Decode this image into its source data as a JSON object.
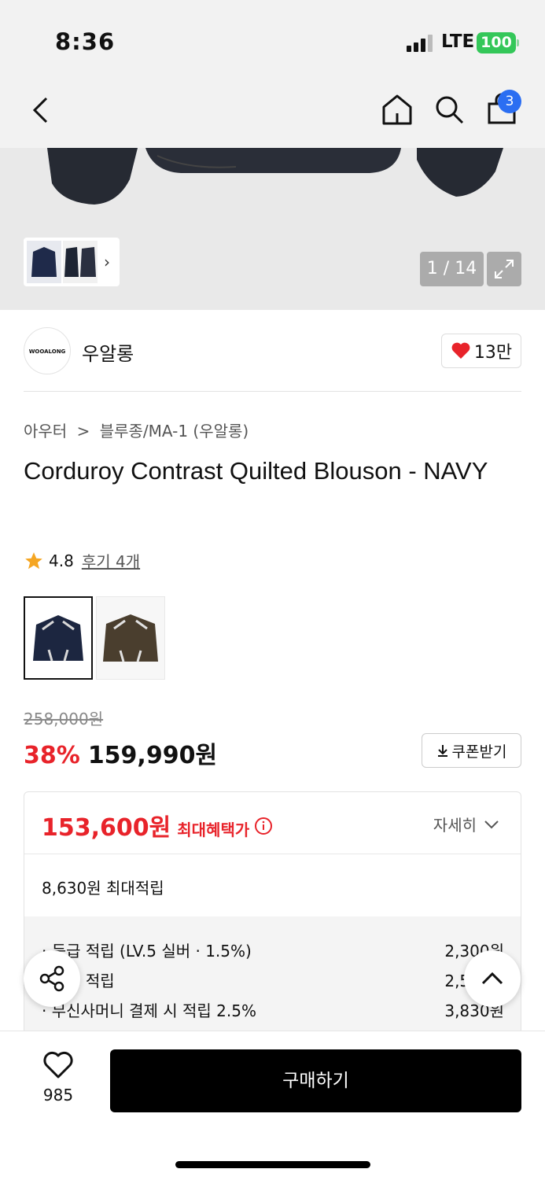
{
  "status_bar": {
    "time": "8:36",
    "network": "LTE",
    "battery": "100"
  },
  "nav": {
    "cart_count": "3"
  },
  "gallery": {
    "counter": "1 / 14"
  },
  "brand": {
    "logo_text": "WOOALONG",
    "name": "우알롱",
    "likes": "13만"
  },
  "breadcrumb": {
    "category": "아우터",
    "separator": ">",
    "subcategory": "블루종/MA-1 (우알롱)"
  },
  "product": {
    "title": "Corduroy Contrast Quilted Blouson - NAVY",
    "rating": "4.8",
    "reviews_label": "후기 4개",
    "original_price": "258,000원",
    "discount": "38%",
    "price": "159,990원",
    "coupon_label": "쿠폰받기"
  },
  "benefits": {
    "max_benefit_price": "153,600원",
    "max_benefit_label": "최대혜택가",
    "detail_label": "자세히",
    "max_points": "8,630원 최대적립",
    "rows": [
      {
        "label": "· 등급 적립 (LV.5 실버 · 1.5%)",
        "value": "2,300원"
      },
      {
        "label": "· 후기 적립",
        "value": "2,500원"
      },
      {
        "label": "· 무신사머니 결제 시 적립 2.5%",
        "value": "3,830원"
      }
    ]
  },
  "bottom": {
    "wish_count": "985",
    "buy_label": "구매하기"
  },
  "colors": {
    "accent_red": "#e8232a",
    "badge_blue": "#2b6ef2",
    "battery_green": "#34c759"
  }
}
